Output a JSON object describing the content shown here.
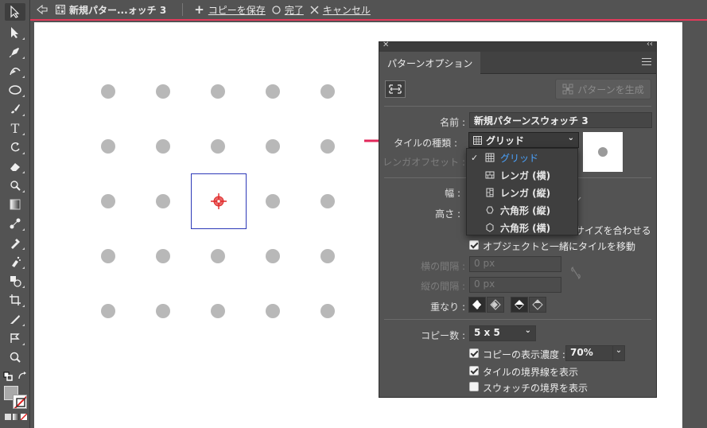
{
  "isolation_bar": {
    "doc_name": "新規パター...ォッチ 3",
    "save_copy": "コピーを保存",
    "done": "完了",
    "cancel": "キャンセル"
  },
  "panel": {
    "tab": "パターンオプション",
    "generate_button": "パターンを生成",
    "name_label": "名前 :",
    "name_value": "新規パターンスウォッチ 3",
    "tile_type_label": "タイルの種類 :",
    "tile_type_value": "グリッド",
    "brick_offset_label": "レンガオフセット :",
    "width_label": "幅 :",
    "height_label": "高さ :",
    "fit_size_label": "サイズを合わせる",
    "move_tile_label": "オブジェクトと一緒にタイルを移動",
    "h_spacing_label": "横の間隔 :",
    "h_spacing_value": "0 px",
    "v_spacing_label": "縦の間隔 :",
    "v_spacing_value": "0 px",
    "overlap_label": "重なり :",
    "copies_label": "コピー数 :",
    "copies_value": "5 x 5",
    "dim_copies_label": "コピーの表示濃度 :",
    "dim_copies_value": "70%",
    "show_tile_edge_label": "タイルの境界線を表示",
    "show_swatch_bounds_label": "スウォッチの境界を表示"
  },
  "tile_type_menu": [
    {
      "label": "グリッド",
      "checked": true
    },
    {
      "label": "レンガ (横)",
      "checked": false
    },
    {
      "label": "レンガ (縦)",
      "checked": false
    },
    {
      "label": "六角形 (縦)",
      "checked": false
    },
    {
      "label": "六角形 (横)",
      "checked": false
    }
  ],
  "checkboxes": {
    "move_tile": true,
    "dim_copies": true,
    "show_tile_edge": true,
    "show_swatch_bounds": false
  },
  "colors": {
    "accent_red": "#e23a5a",
    "tile_border": "#2d39b8",
    "selected_menu_text": "#4aa3ff",
    "dot": "#b8b8b8"
  }
}
